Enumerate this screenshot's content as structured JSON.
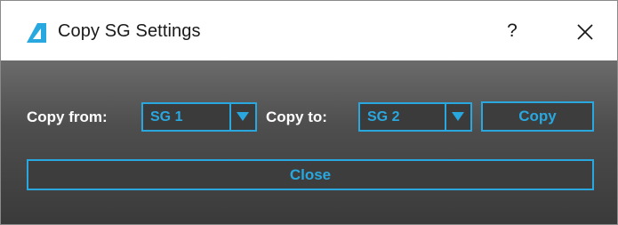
{
  "window": {
    "title": "Copy SG Settings",
    "help_label": "?"
  },
  "form": {
    "copy_from_label": "Copy from:",
    "copy_from_value": "SG 1",
    "copy_to_label": "Copy to:",
    "copy_to_value": "SG 2",
    "copy_button_label": "Copy",
    "close_button_label": "Close"
  },
  "icons": {
    "app": "app-logo-icon",
    "help": "help-icon",
    "close": "close-icon",
    "dropdown": "dropdown-arrow-icon"
  },
  "colors": {
    "accent": "#29a8e0",
    "panel_top": "#6b6b6b",
    "panel_bottom": "#3a3a3a",
    "label_text": "#ffffff"
  }
}
